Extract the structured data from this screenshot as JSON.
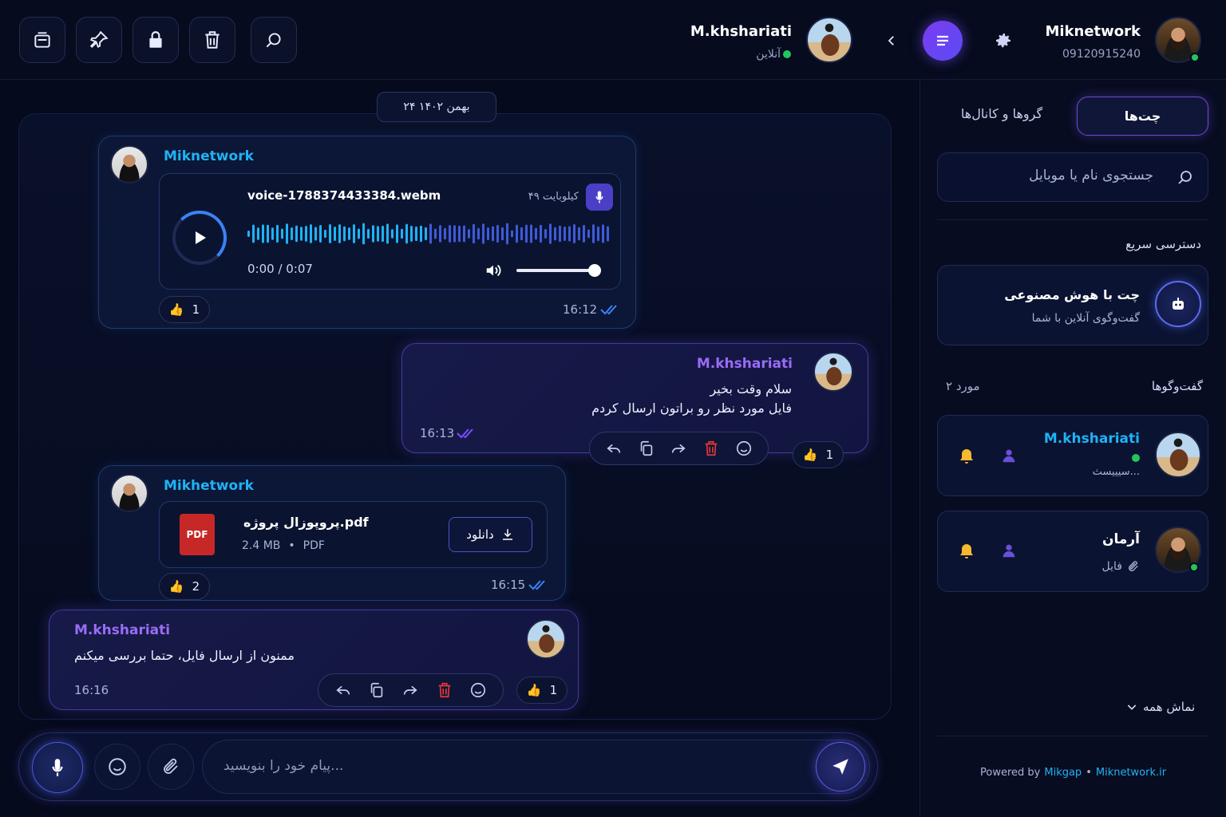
{
  "header": {
    "tools": [
      "window-icon",
      "pin-icon",
      "lock-icon",
      "trash-icon",
      "search-icon"
    ],
    "contact_name": "M.khshariati",
    "contact_status": "آنلاین",
    "user_name": "Miknetwork",
    "user_phone": "09120915240"
  },
  "chat": {
    "date": "۲۴ بهمن ۱۴۰۲",
    "messages": [
      {
        "sender": "Miknetwork",
        "file_name": "voice-1788374433384.webm",
        "file_size": "۴۹ کیلوبایت",
        "duration": "0:00 / 0:07",
        "time": "16:12",
        "reaction_count": "1"
      },
      {
        "sender": "M.khshariati",
        "line1": "سلام وقت بخیر",
        "line2": "فایل مورد نظر رو براتون ارسال کردم",
        "time": "16:13",
        "reaction_count": "1"
      },
      {
        "sender": "Mikhetwork",
        "file_name": "پروپوزال پروژه.pdf",
        "file_size": "2.4 MB",
        "file_type": "PDF",
        "pdf_label": "PDF",
        "download_label": "دانلود",
        "time": "16:15",
        "reaction_count": "2"
      },
      {
        "sender": "M.khshariati",
        "text": "ممنون از ارسال فایل، حتما بررسی میکنم",
        "time": "16:16",
        "reaction_count": "1"
      }
    ]
  },
  "composer": {
    "placeholder": "پیام خود را بنویسید..."
  },
  "sidebar": {
    "tab_chats": "چت‌ها",
    "tab_groups": "گروها و کانال‌ها",
    "search_placeholder": "جستجوی نام یا موبایل",
    "quick_access_label": "دسترسی سریع",
    "ai_title": "چت با هوش مصنوعی",
    "ai_subtitle": "گفت‌وگوی آنلاین با شما",
    "conversations_label": "گفت‌وگوها",
    "conversations_count": "۲ مورد",
    "conversations": [
      {
        "name": "M.khshariati",
        "preview": "سیییسث..."
      },
      {
        "name": "آرمان",
        "preview": "فایل"
      }
    ],
    "show_all": "نماش همه",
    "powered_prefix": "Powered by",
    "powered_brand": "Mikgap",
    "powered_site": "Miknetwork.ir"
  },
  "colors": {
    "accent_purple": "#7c4dff",
    "accent_blue": "#1fb3f5",
    "online": "#22c55e",
    "delete": "#e53935"
  }
}
